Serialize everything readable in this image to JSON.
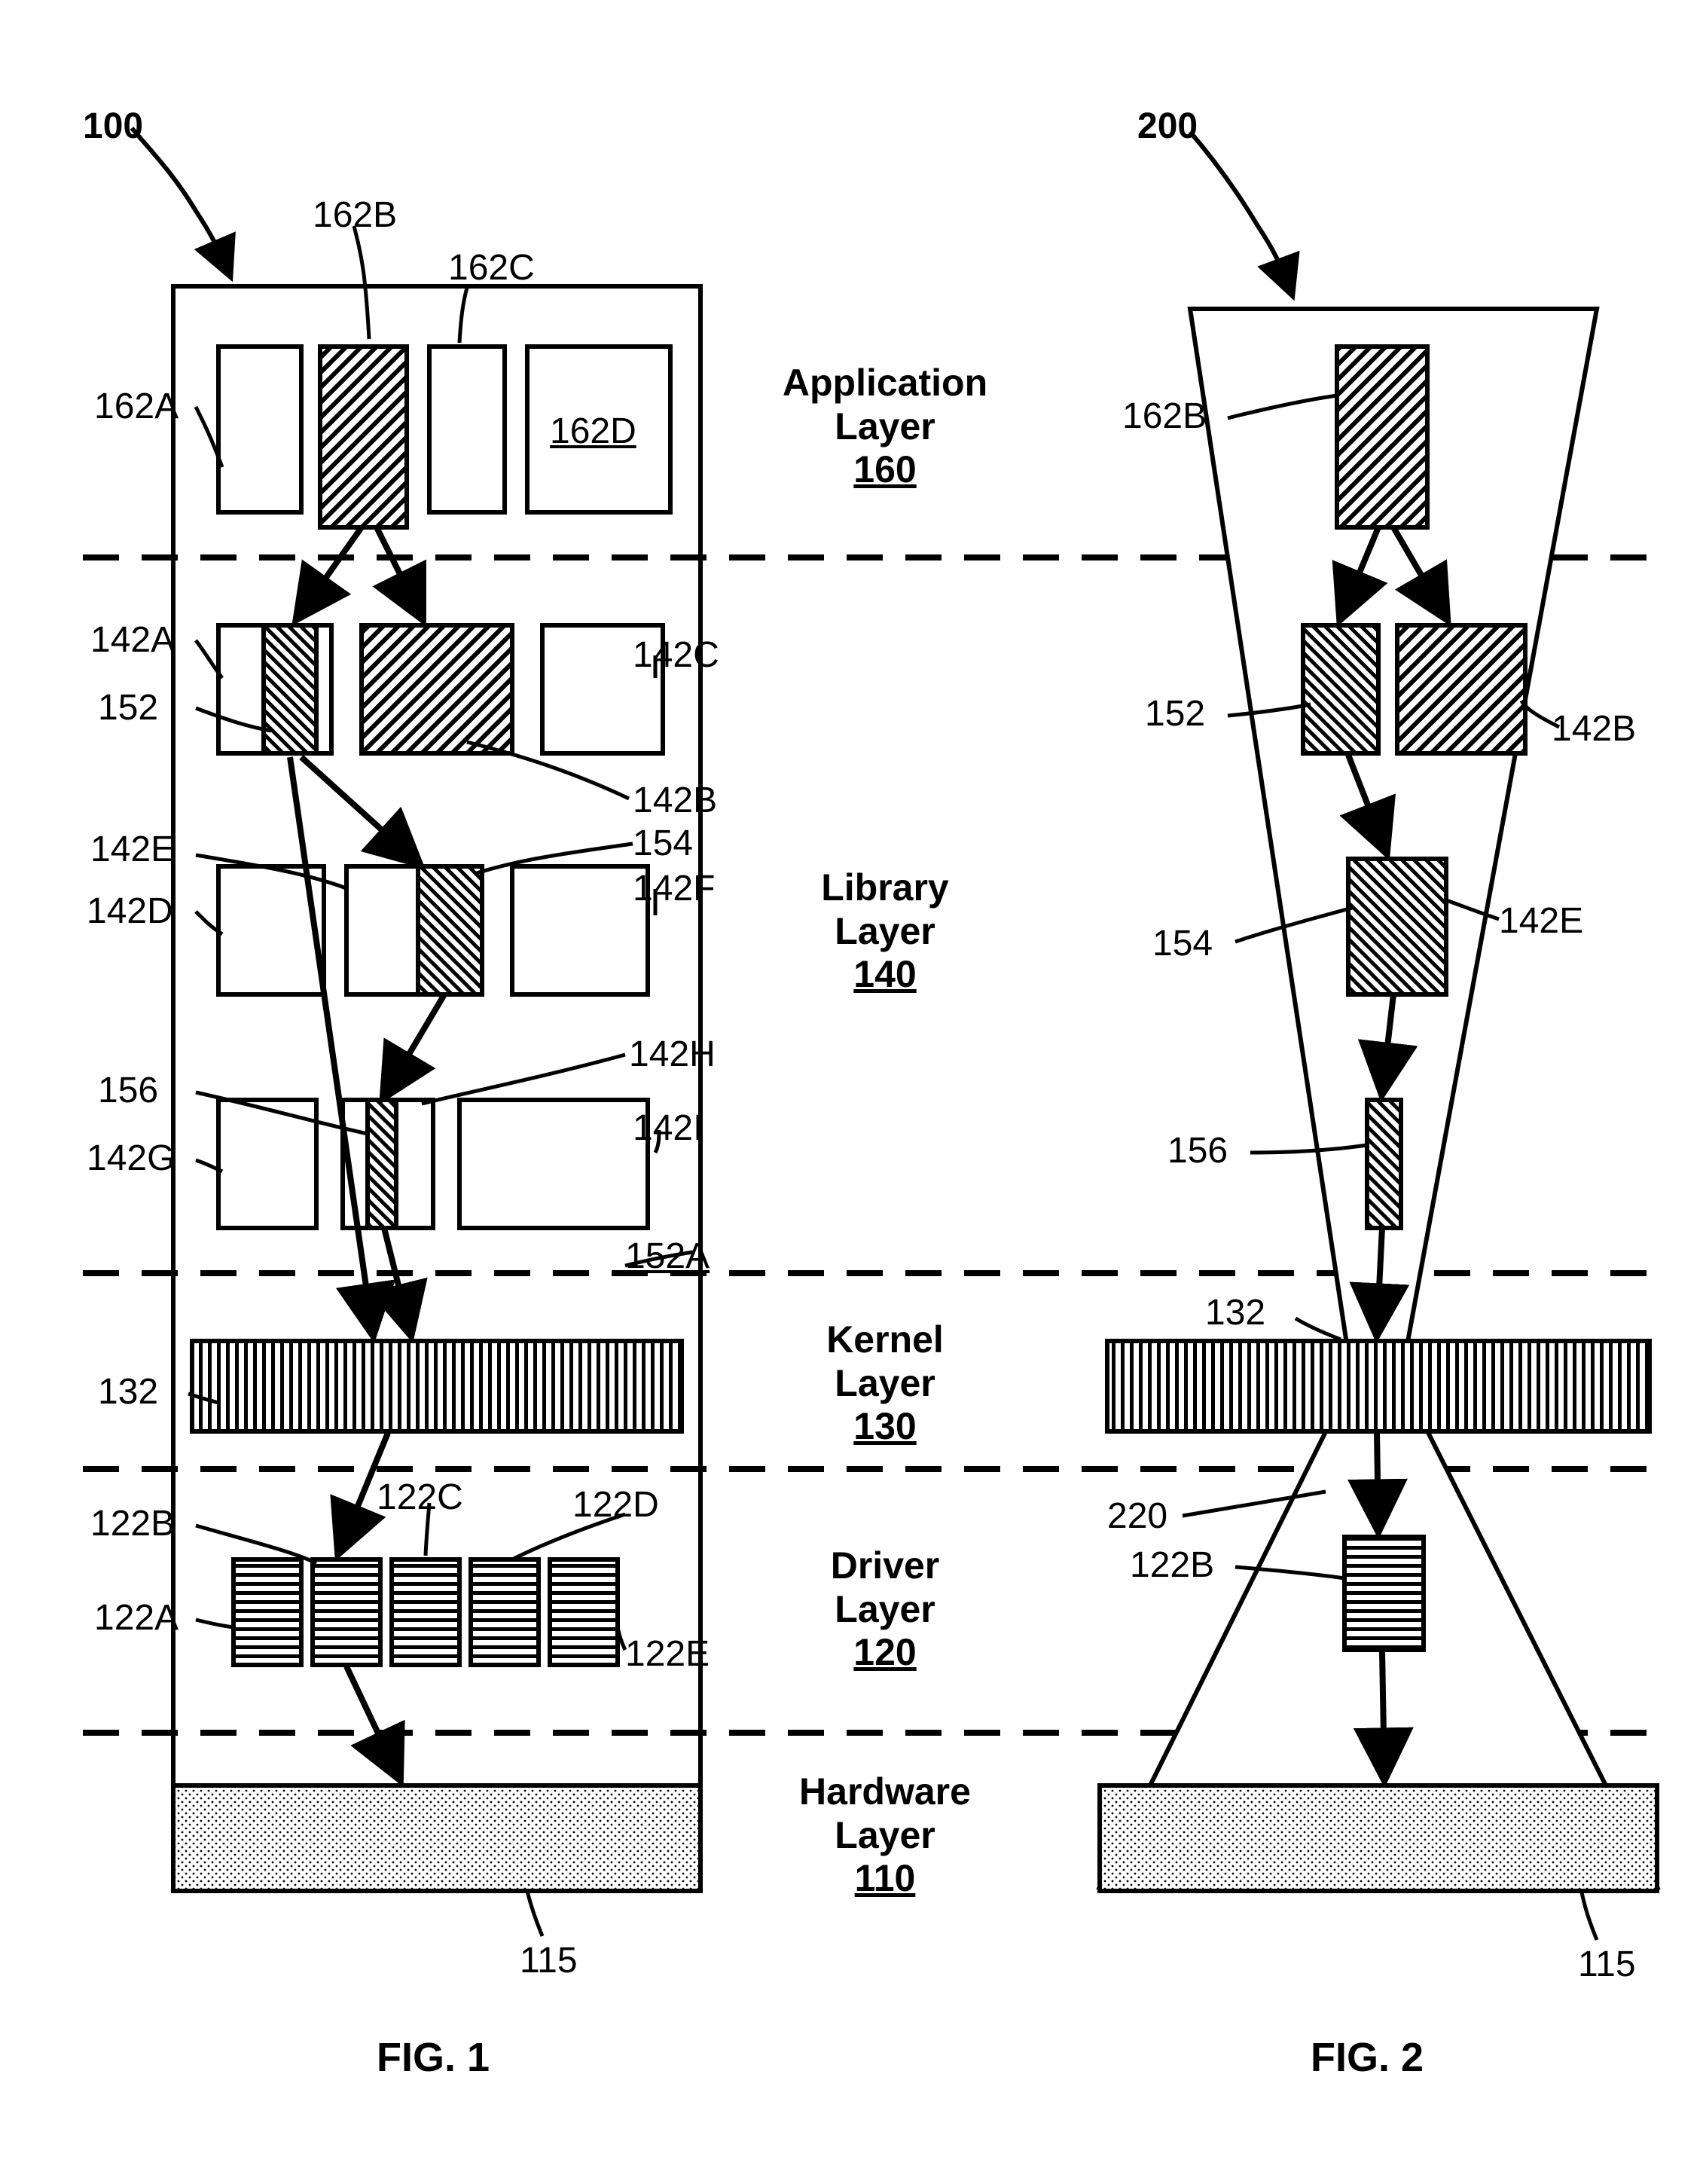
{
  "fig1": {
    "id": "100",
    "caption": "FIG. 1"
  },
  "fig2": {
    "id": "200",
    "caption": "FIG. 2"
  },
  "layers": {
    "application": {
      "title_l1": "Application",
      "title_l2": "Layer",
      "ref": "160"
    },
    "library": {
      "title_l1": "Library",
      "title_l2": "Layer",
      "ref": "140"
    },
    "kernel": {
      "title_l1": "Kernel",
      "title_l2": "Layer",
      "ref": "130"
    },
    "driver": {
      "title_l1": "Driver",
      "title_l2": "Layer",
      "ref": "120"
    },
    "hardware": {
      "title_l1": "Hardware",
      "title_l2": "Layer",
      "ref": "110"
    }
  },
  "refs": {
    "app": {
      "a": "162A",
      "b": "162B",
      "c": "162C",
      "d": "162D"
    },
    "lib_row1": {
      "a": "142A",
      "b": "142B",
      "c": "142C",
      "s": "152"
    },
    "lib_row2": {
      "d": "142D",
      "e": "142E",
      "f": "142F",
      "s": "154"
    },
    "lib_row3": {
      "g": "142G",
      "h": "142H",
      "i": "142I",
      "s": "156"
    },
    "kernel_bar": "132",
    "drivers": {
      "a": "122A",
      "b": "122B",
      "c": "122C",
      "d": "122D",
      "e": "122E"
    },
    "hw": "115",
    "fig2_only": {
      "funnel": "220",
      "extra": "152A"
    }
  }
}
